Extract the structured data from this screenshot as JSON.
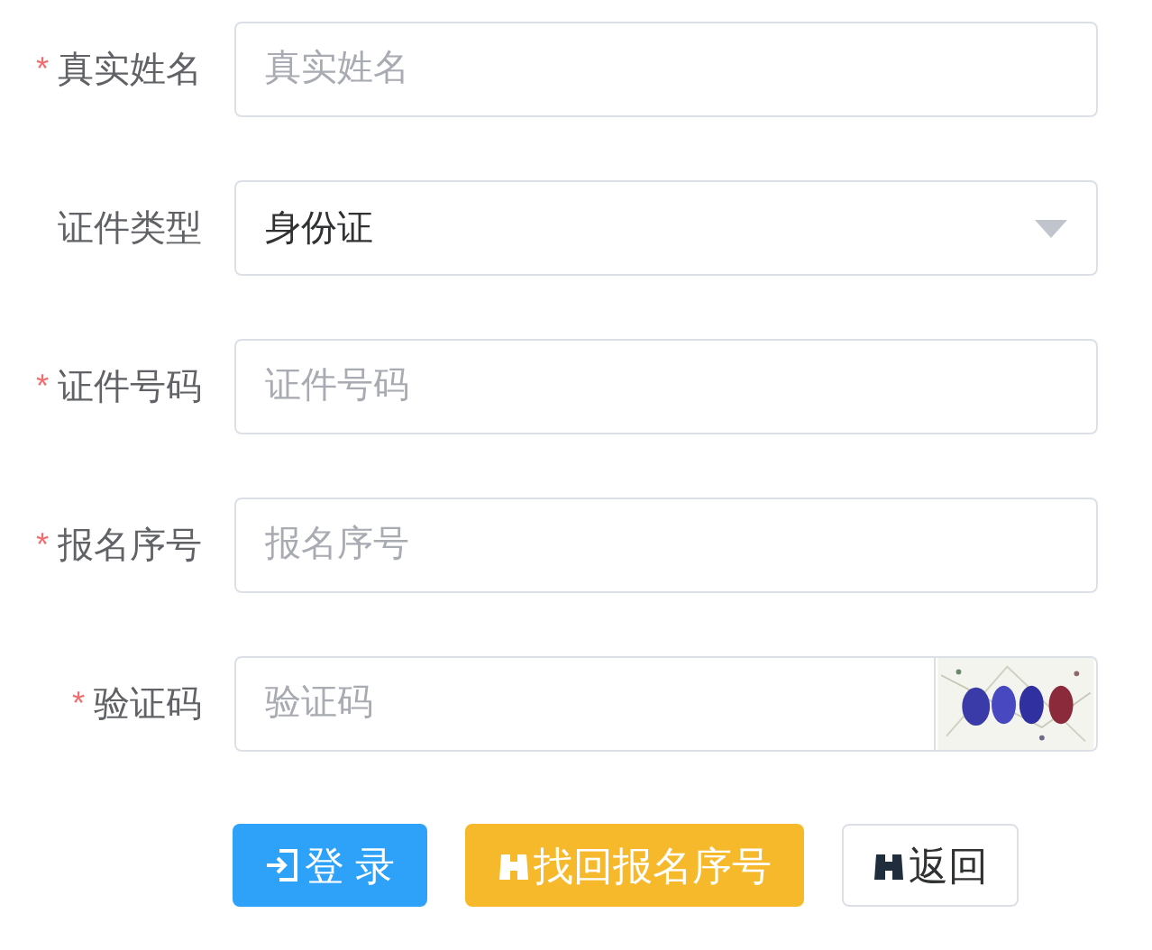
{
  "fields": [
    {
      "label": "真实姓名",
      "required_mark": "*",
      "kind": "input",
      "placeholder": "真实姓名"
    },
    {
      "label": "证件类型",
      "kind": "select",
      "value": "身份证"
    },
    {
      "label": "证件号码",
      "required_mark": "*",
      "kind": "input",
      "placeholder": "证件号码"
    },
    {
      "label": "报名序号",
      "required_mark": "*",
      "kind": "input",
      "placeholder": "报名序号"
    },
    {
      "label": "验证码",
      "required_mark": "*",
      "kind": "captcha",
      "placeholder": "验证码"
    }
  ],
  "buttons": [
    {
      "label": "登 录",
      "kind": "primary"
    },
    {
      "label": "找回报名序号",
      "kind": "warning"
    },
    {
      "label": "返回",
      "kind": "default"
    }
  ]
}
